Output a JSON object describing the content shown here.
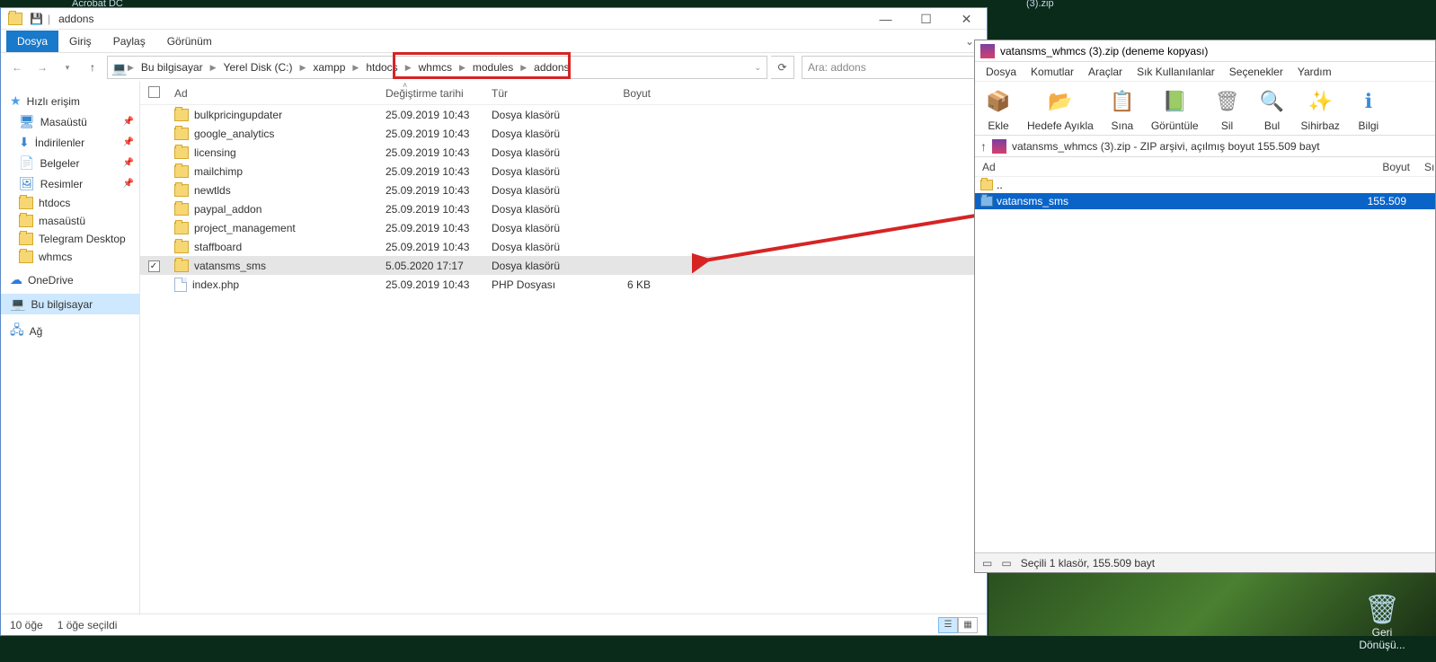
{
  "taskbar": {
    "acrobat": "Acrobat DC",
    "zip": "(3).zip"
  },
  "explorer": {
    "title": "addons",
    "tabs": {
      "file": "Dosya",
      "home": "Giriş",
      "share": "Paylaş",
      "view": "Görünüm"
    },
    "breadcrumb": [
      "Bu bilgisayar",
      "Yerel Disk (C:)",
      "xampp",
      "htdocs",
      "whmcs",
      "modules",
      "addons"
    ],
    "search_placeholder": "Ara: addons",
    "columns": {
      "name": "Ad",
      "modified": "Değiştirme tarihi",
      "type": "Tür",
      "size": "Boyut"
    },
    "sidebar": {
      "quick": "Hızlı erişim",
      "desktop": "Masaüstü",
      "downloads": "İndirilenler",
      "documents": "Belgeler",
      "pictures": "Resimler",
      "htdocs": "htdocs",
      "masa2": "masaüstü",
      "telegram": "Telegram Desktop",
      "whmcs": "whmcs",
      "onedrive": "OneDrive",
      "thispc": "Bu bilgisayar",
      "network": "Ağ"
    },
    "rows": [
      {
        "name": "bulkpricingupdater",
        "date": "25.09.2019 10:43",
        "type": "Dosya klasörü",
        "size": "",
        "kind": "folder",
        "sel": false
      },
      {
        "name": "google_analytics",
        "date": "25.09.2019 10:43",
        "type": "Dosya klasörü",
        "size": "",
        "kind": "folder",
        "sel": false
      },
      {
        "name": "licensing",
        "date": "25.09.2019 10:43",
        "type": "Dosya klasörü",
        "size": "",
        "kind": "folder",
        "sel": false
      },
      {
        "name": "mailchimp",
        "date": "25.09.2019 10:43",
        "type": "Dosya klasörü",
        "size": "",
        "kind": "folder",
        "sel": false
      },
      {
        "name": "newtlds",
        "date": "25.09.2019 10:43",
        "type": "Dosya klasörü",
        "size": "",
        "kind": "folder",
        "sel": false
      },
      {
        "name": "paypal_addon",
        "date": "25.09.2019 10:43",
        "type": "Dosya klasörü",
        "size": "",
        "kind": "folder",
        "sel": false
      },
      {
        "name": "project_management",
        "date": "25.09.2019 10:43",
        "type": "Dosya klasörü",
        "size": "",
        "kind": "folder",
        "sel": false
      },
      {
        "name": "staffboard",
        "date": "25.09.2019 10:43",
        "type": "Dosya klasörü",
        "size": "",
        "kind": "folder",
        "sel": false
      },
      {
        "name": "vatansms_sms",
        "date": "5.05.2020 17:17",
        "type": "Dosya klasörü",
        "size": "",
        "kind": "folder",
        "sel": true
      },
      {
        "name": "index.php",
        "date": "25.09.2019 10:43",
        "type": "PHP Dosyası",
        "size": "6 KB",
        "kind": "php",
        "sel": false
      }
    ],
    "status": {
      "items": "10 öğe",
      "selected": "1 öğe seçildi"
    }
  },
  "rar": {
    "title": "vatansms_whmcs (3).zip (deneme kopyası)",
    "menu": [
      "Dosya",
      "Komutlar",
      "Araçlar",
      "Sık Kullanılanlar",
      "Seçenekler",
      "Yardım"
    ],
    "toolbar": [
      {
        "label": "Ekle",
        "color": "#e76a2e"
      },
      {
        "label": "Hedefe Ayıkla",
        "color": "#3a8ad6"
      },
      {
        "label": "Sına",
        "color": "#d64a4a"
      },
      {
        "label": "Görüntüle",
        "color": "#4aa050"
      },
      {
        "label": "Sil",
        "color": "#888"
      },
      {
        "label": "Bul",
        "color": "#3a8ad6"
      },
      {
        "label": "Sihirbaz",
        "color": "#d6a030"
      },
      {
        "label": "Bilgi",
        "color": "#3a8ad6"
      }
    ],
    "path": "vatansms_whmcs (3).zip - ZIP arşivi, açılmış boyut 155.509 bayt",
    "cols": {
      "name": "Ad",
      "size": "Boyut",
      "s": "Sı"
    },
    "rows": [
      {
        "name": "..",
        "size": "",
        "sel": false,
        "up": true
      },
      {
        "name": "vatansms_sms",
        "size": "155.509",
        "sel": true,
        "up": false
      }
    ],
    "status": "Seçili 1 klasör, 155.509 bayt"
  },
  "desktop": {
    "recycle": "Geri Dönüşü..."
  }
}
